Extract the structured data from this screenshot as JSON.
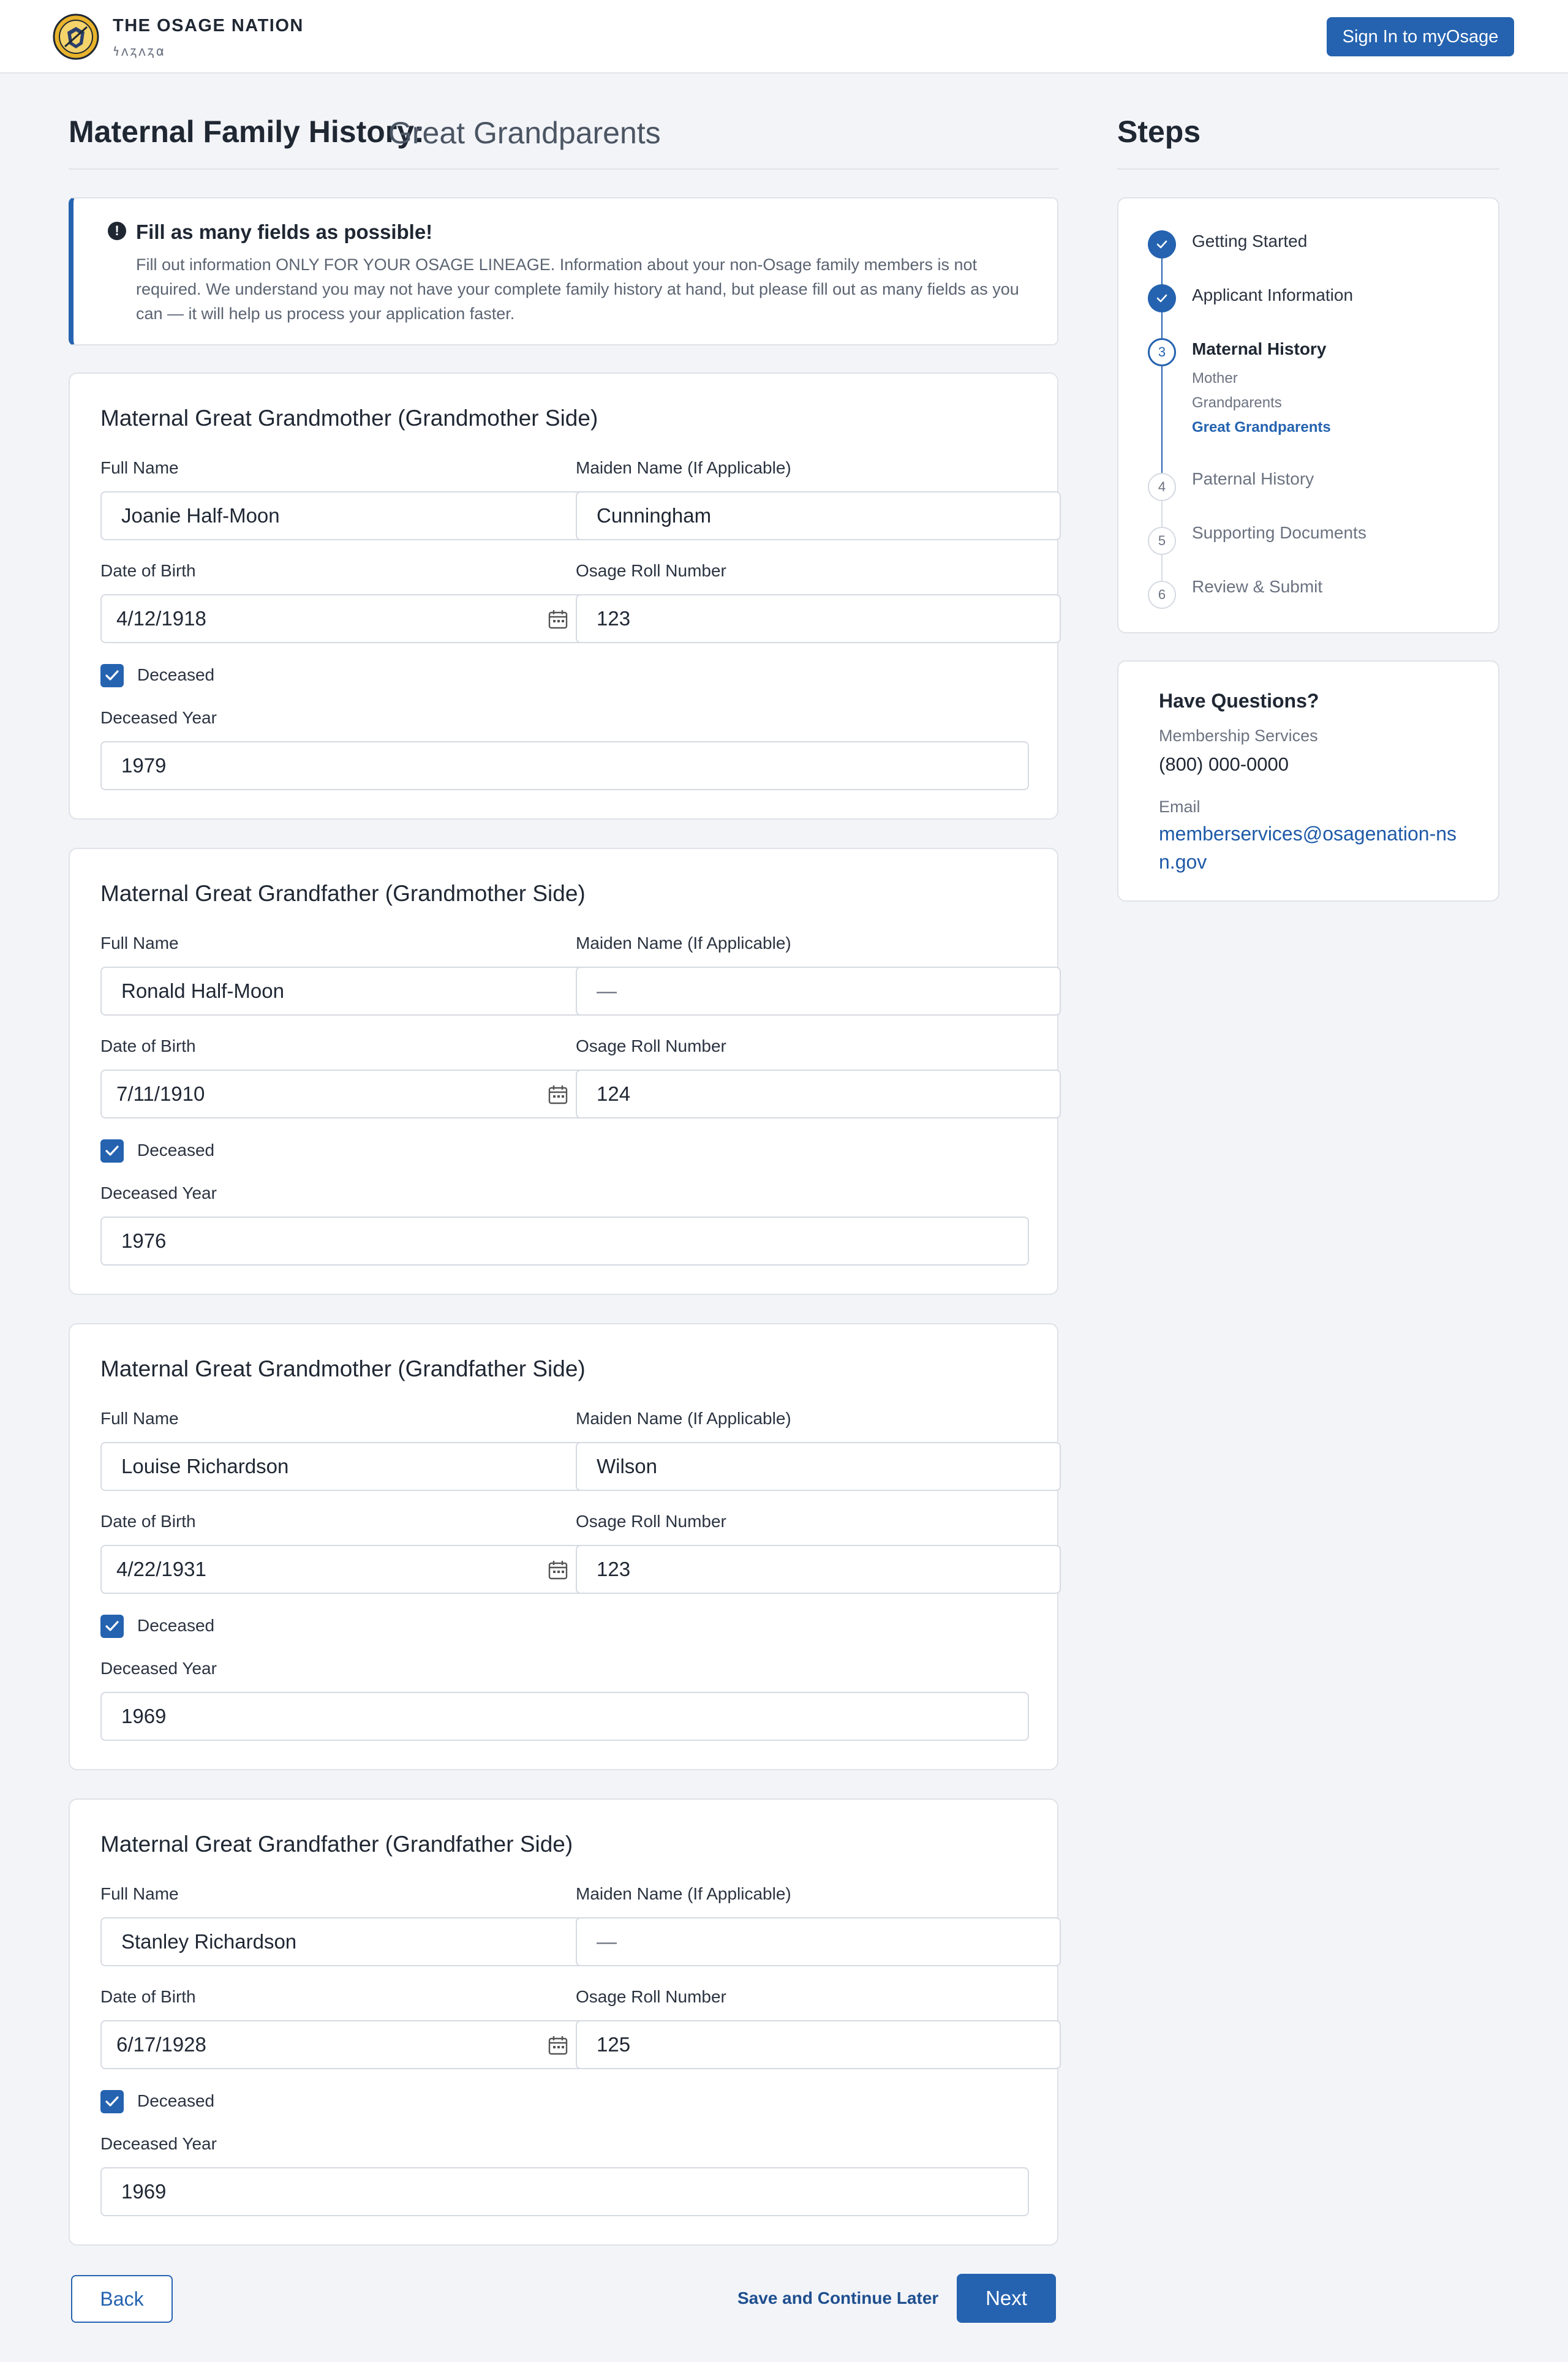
{
  "header": {
    "brand_name": "THE OSAGE NATION",
    "brand_osage": "𐓏𐓘𐓻𐓘𐓻𐓟",
    "signin_label": "Sign In to myOsage"
  },
  "page": {
    "title": "Maternal Family History:",
    "subtitle": "Great Grandparents"
  },
  "alert": {
    "title": "Fill as many fields as possible!",
    "body": "Fill out information ONLY FOR YOUR OSAGE LINEAGE. Information about your non-Osage family members is not required. We understand you may not have your complete family history at hand, but please fill out as many fields as you can — it will help us process your application faster."
  },
  "labels": {
    "full_name": "Full Name",
    "maiden_name": "Maiden Name (If Applicable)",
    "dob": "Date of Birth",
    "roll_number": "Osage Roll Number",
    "deceased": "Deceased",
    "deceased_year": "Deceased Year"
  },
  "cards": [
    {
      "title": "Maternal Great Grandmother (Grandmother Side)",
      "full_name": "Joanie Half-Moon",
      "maiden_name": "Cunningham",
      "dob": "4/12/1918",
      "roll_number": "123",
      "deceased": true,
      "deceased_year": "1979"
    },
    {
      "title": "Maternal Great Grandfather (Grandmother Side)",
      "full_name": "Ronald Half-Moon",
      "maiden_name": "—",
      "dob": "7/11/1910",
      "roll_number": "124",
      "deceased": true,
      "deceased_year": "1976"
    },
    {
      "title": "Maternal Great Grandmother (Grandfather Side)",
      "full_name": "Louise Richardson",
      "maiden_name": "Wilson",
      "dob": "4/22/1931",
      "roll_number": "123",
      "deceased": true,
      "deceased_year": "1969"
    },
    {
      "title": "Maternal Great Grandfather (Grandfather Side)",
      "full_name": "Stanley Richardson",
      "maiden_name": "—",
      "dob": "6/17/1928",
      "roll_number": "125",
      "deceased": true,
      "deceased_year": "1969"
    }
  ],
  "steps": {
    "title": "Steps",
    "items": [
      {
        "number": "1",
        "label": "Getting Started",
        "state": "done"
      },
      {
        "number": "2",
        "label": "Applicant Information",
        "state": "done"
      },
      {
        "number": "3",
        "label": "Maternal History",
        "state": "current",
        "sub_items": [
          "Mother",
          "Grandparents",
          "Great Grandparents"
        ]
      },
      {
        "number": "4",
        "label": "Paternal History",
        "state": "todo"
      },
      {
        "number": "5",
        "label": "Supporting Documents",
        "state": "todo"
      },
      {
        "number": "6",
        "label": "Review & Submit",
        "state": "todo"
      }
    ]
  },
  "help": {
    "title": "Have Questions?",
    "services_label": "Membership Services",
    "phone": "(800) 000-0000",
    "email_label": "Email",
    "email": "memberservices@osagenation-nsn.gov"
  },
  "footer": {
    "back_label": "Back",
    "save_label": "Save and Continue Later",
    "next_label": "Next"
  },
  "colors": {
    "primary": "#2563b0",
    "background": "#f3f4f8",
    "card_border": "#dfe2e8"
  }
}
